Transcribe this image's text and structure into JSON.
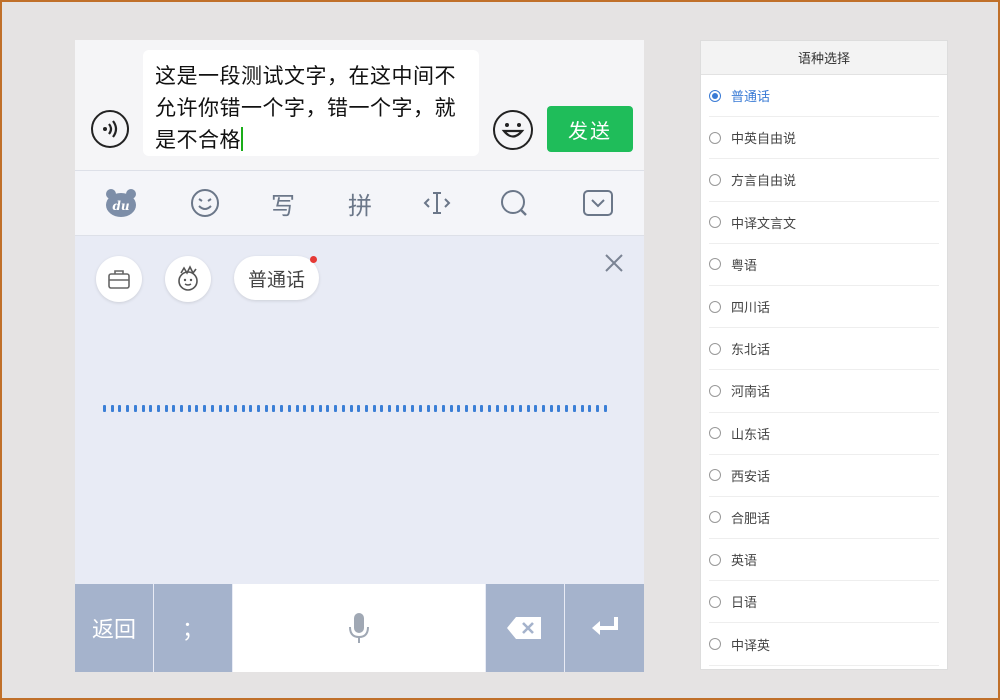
{
  "chat": {
    "message_text": "这是一段测试文字，在这中间不允许你错一个字，错一个字，就是不合格",
    "send_label": "发送"
  },
  "toolbar": {
    "items": [
      {
        "name": "du-logo-icon",
        "glyph": ""
      },
      {
        "name": "emoji-panel-icon",
        "glyph": ""
      },
      {
        "name": "handwrite",
        "glyph": "写"
      },
      {
        "name": "pinyin",
        "glyph": "拼"
      },
      {
        "name": "cursor-icon",
        "glyph": ""
      },
      {
        "name": "search-icon",
        "glyph": ""
      },
      {
        "name": "collapse-icon",
        "glyph": ""
      }
    ]
  },
  "voice": {
    "language_chip": "普通话"
  },
  "bottom_keys": {
    "back_label": "返回",
    "punct_label": "；"
  },
  "language_panel": {
    "title": "语种选择",
    "selected": "普通话",
    "options": [
      "普通话",
      "中英自由说",
      "方言自由说",
      "中译文言文",
      "粤语",
      "四川话",
      "东北话",
      "河南话",
      "山东话",
      "西安话",
      "合肥话",
      "英语",
      "日语",
      "中译英"
    ]
  },
  "colors": {
    "send_green": "#1fbd5a",
    "wave_blue": "#3b7fd6",
    "selected_blue": "#3a7bd5",
    "key_gray_blue": "#a5b3cc"
  }
}
